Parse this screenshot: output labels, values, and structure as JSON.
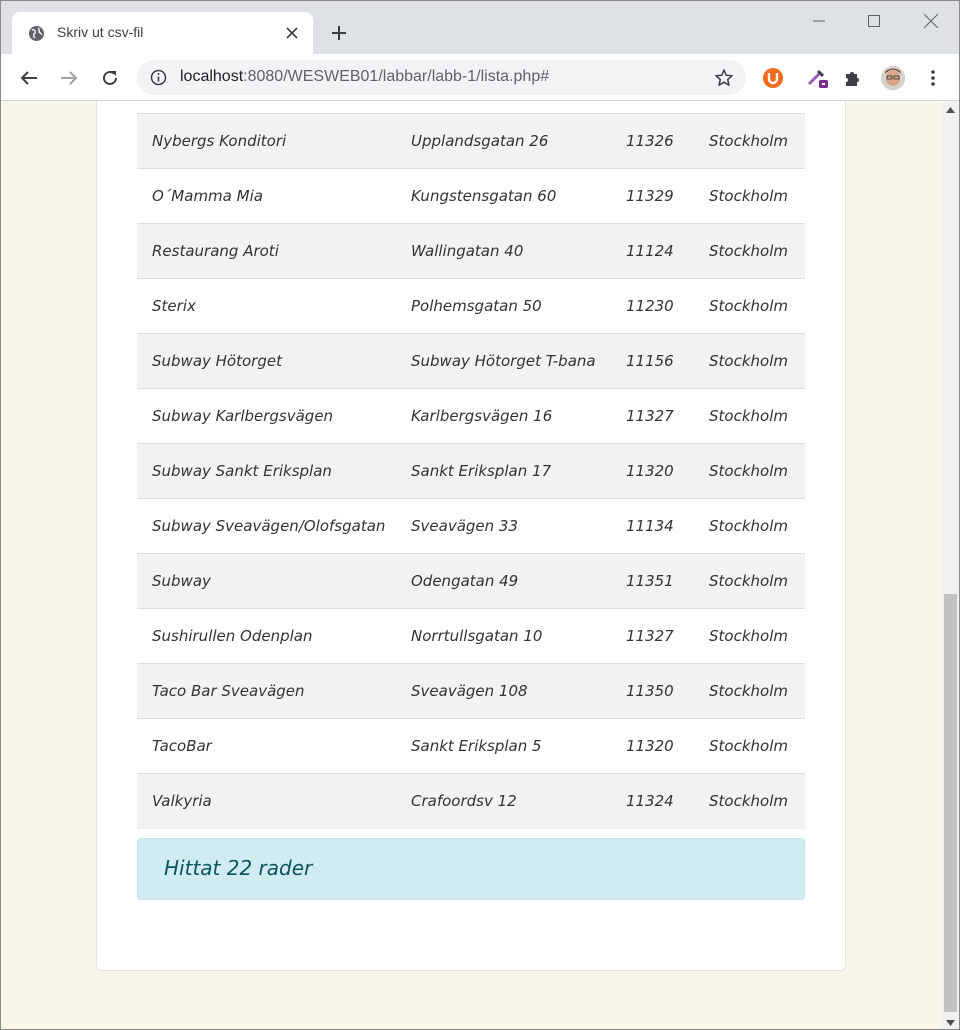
{
  "browser": {
    "tab_title": "Skriv ut csv-fil",
    "url_host": "localhost",
    "url_path": ":8080/WESWEB01/labbar/labb-1/lista.php#",
    "icons": {
      "favicon": "globe-icon",
      "tab_close": "close-icon",
      "new_tab": "plus-icon",
      "back": "back-arrow-icon",
      "forward": "forward-arrow-icon",
      "reload": "reload-icon",
      "site_info": "info-icon",
      "bookmark": "star-icon",
      "ext1": "ublock-icon",
      "ext2": "eyedropper-icon",
      "extensions": "puzzle-icon",
      "menu": "kebab-menu-icon"
    }
  },
  "table": {
    "rows": [
      {
        "name": "Nybergs Konditori",
        "address": "Upplandsgatan 26",
        "zip": "11326",
        "city": "Stockholm"
      },
      {
        "name": "O´Mamma Mia",
        "address": "Kungstensgatan 60",
        "zip": "11329",
        "city": "Stockholm"
      },
      {
        "name": "Restaurang Aroti",
        "address": "Wallingatan 40",
        "zip": "11124",
        "city": "Stockholm"
      },
      {
        "name": "Sterix",
        "address": "Polhemsgatan 50",
        "zip": "11230",
        "city": "Stockholm"
      },
      {
        "name": "Subway Hötorget",
        "address": "Subway Hötorget T-bana",
        "zip": "11156",
        "city": "Stockholm"
      },
      {
        "name": "Subway Karlbergsvägen",
        "address": "Karlbergsvägen 16",
        "zip": "11327",
        "city": "Stockholm"
      },
      {
        "name": "Subway Sankt Eriksplan",
        "address": "Sankt Eriksplan 17",
        "zip": "11320",
        "city": "Stockholm"
      },
      {
        "name": "Subway Sveavägen/Olofsgatan",
        "address": "Sveavägen 33",
        "zip": "11134",
        "city": "Stockholm"
      },
      {
        "name": "Subway",
        "address": "Odengatan 49",
        "zip": "11351",
        "city": "Stockholm"
      },
      {
        "name": "Sushirullen Odenplan",
        "address": "Norrtullsgatan 10",
        "zip": "11327",
        "city": "Stockholm"
      },
      {
        "name": "Taco Bar Sveavägen",
        "address": "Sveavägen 108",
        "zip": "11350",
        "city": "Stockholm"
      },
      {
        "name": "TacoBar",
        "address": "Sankt Eriksplan 5",
        "zip": "11320",
        "city": "Stockholm"
      },
      {
        "name": "Valkyria",
        "address": "Crafoordsv 12",
        "zip": "11324",
        "city": "Stockholm"
      }
    ]
  },
  "result_message": "Hittat 22 rader",
  "colors": {
    "page_background": "#f8f5e9",
    "row_striped": "#f2f2f2",
    "alert_background": "#d1ecf1",
    "alert_text": "#0c5460"
  }
}
